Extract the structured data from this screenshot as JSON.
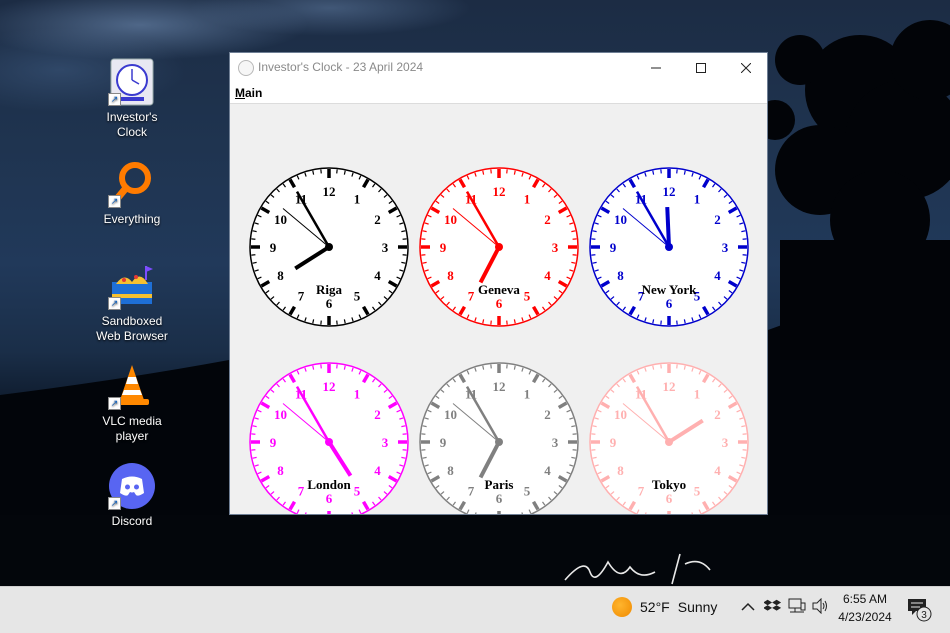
{
  "desktop": {
    "icons": [
      {
        "label": "Investor's\nClock",
        "icon": "clock-icon"
      },
      {
        "label": "Everything",
        "icon": "magnifier-icon"
      },
      {
        "label": "Sandboxed\nWeb Browser",
        "icon": "sandbox-icon"
      },
      {
        "label": "VLC media\nplayer",
        "icon": "traffic-cone-icon"
      },
      {
        "label": "Discord",
        "icon": "discord-icon"
      }
    ]
  },
  "window": {
    "title": "Investor's Clock - 23 April 2024",
    "menu": {
      "main_label": "Main",
      "main_accel": "M",
      "main_rest": "ain"
    },
    "clocks": [
      {
        "city": "Riga",
        "color": "#000000",
        "hour": 7,
        "minute": 55
      },
      {
        "city": "Geneva",
        "color": "#ff0000",
        "hour": 6,
        "minute": 55
      },
      {
        "city": "New York",
        "color": "#0000cc",
        "hour": 11,
        "minute": 55
      },
      {
        "city": "London",
        "color": "#ff00ff",
        "hour": 4,
        "minute": 55
      },
      {
        "city": "Paris",
        "color": "#808080",
        "hour": 6,
        "minute": 55
      },
      {
        "city": "Tokyo",
        "color": "#ffb0b0",
        "hour": 1,
        "minute": 55
      }
    ],
    "numerals": [
      "12",
      "1",
      "2",
      "3",
      "4",
      "5",
      "6",
      "7",
      "8",
      "9",
      "10",
      "11"
    ]
  },
  "taskbar": {
    "weather_temp": "52°F",
    "weather_text": "Sunny",
    "time": "6:55 AM",
    "date": "4/23/2024",
    "notification_count": "3"
  }
}
